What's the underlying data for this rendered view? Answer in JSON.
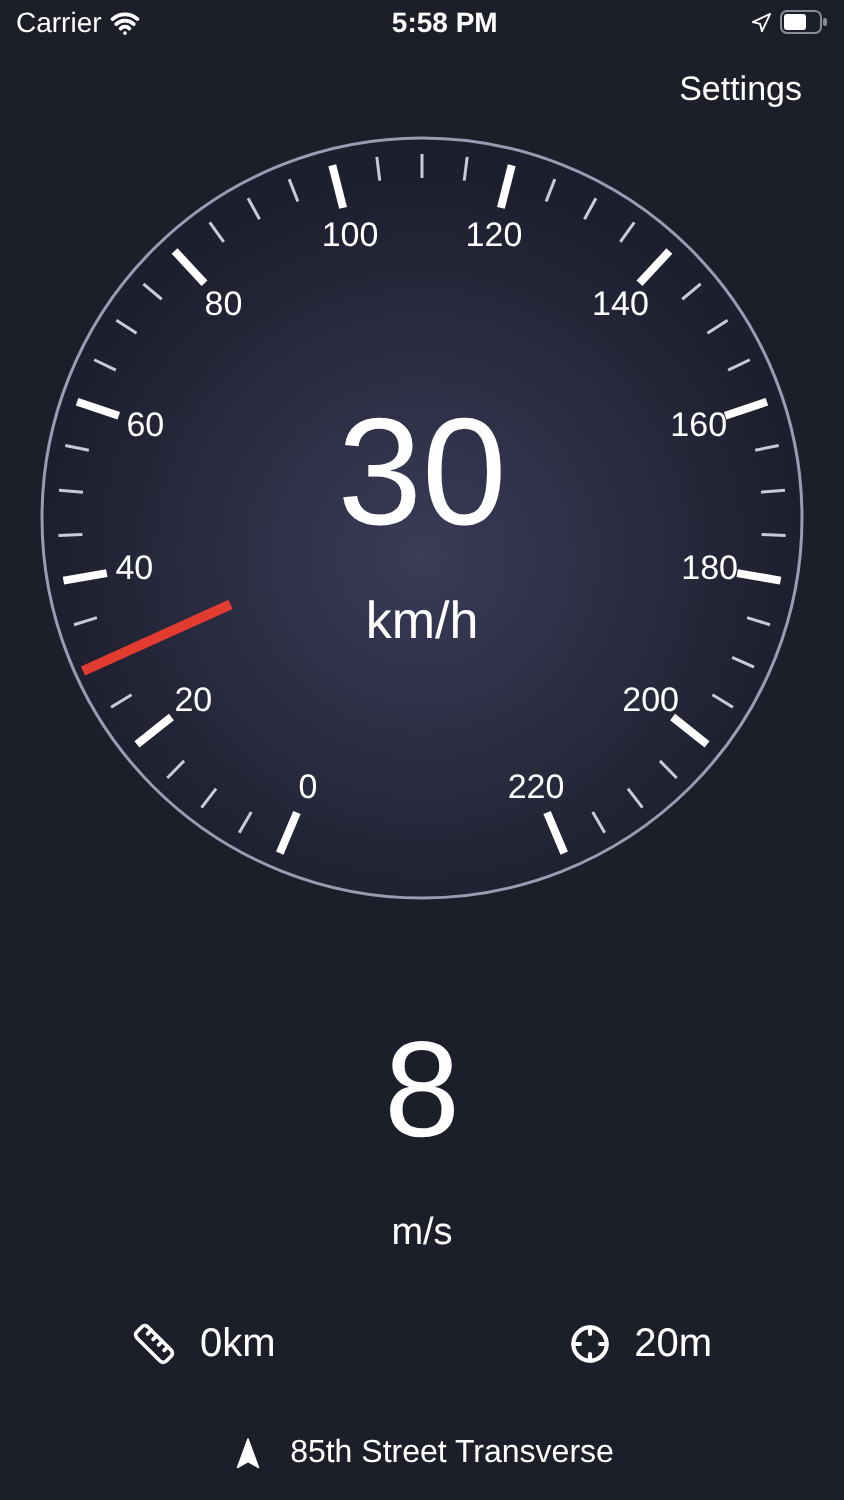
{
  "status_bar": {
    "carrier": "Carrier",
    "time": "5:58 PM"
  },
  "settings_button": "Settings",
  "gauge": {
    "speed": "30",
    "unit": "km/h",
    "scale_labels": [
      "0",
      "20",
      "40",
      "60",
      "80",
      "100",
      "120",
      "140",
      "160",
      "180",
      "200",
      "220"
    ]
  },
  "secondary_speed": {
    "value": "8",
    "unit": "m/s"
  },
  "distance": "0km",
  "accuracy": "20m",
  "street": "85th Street Transverse"
}
